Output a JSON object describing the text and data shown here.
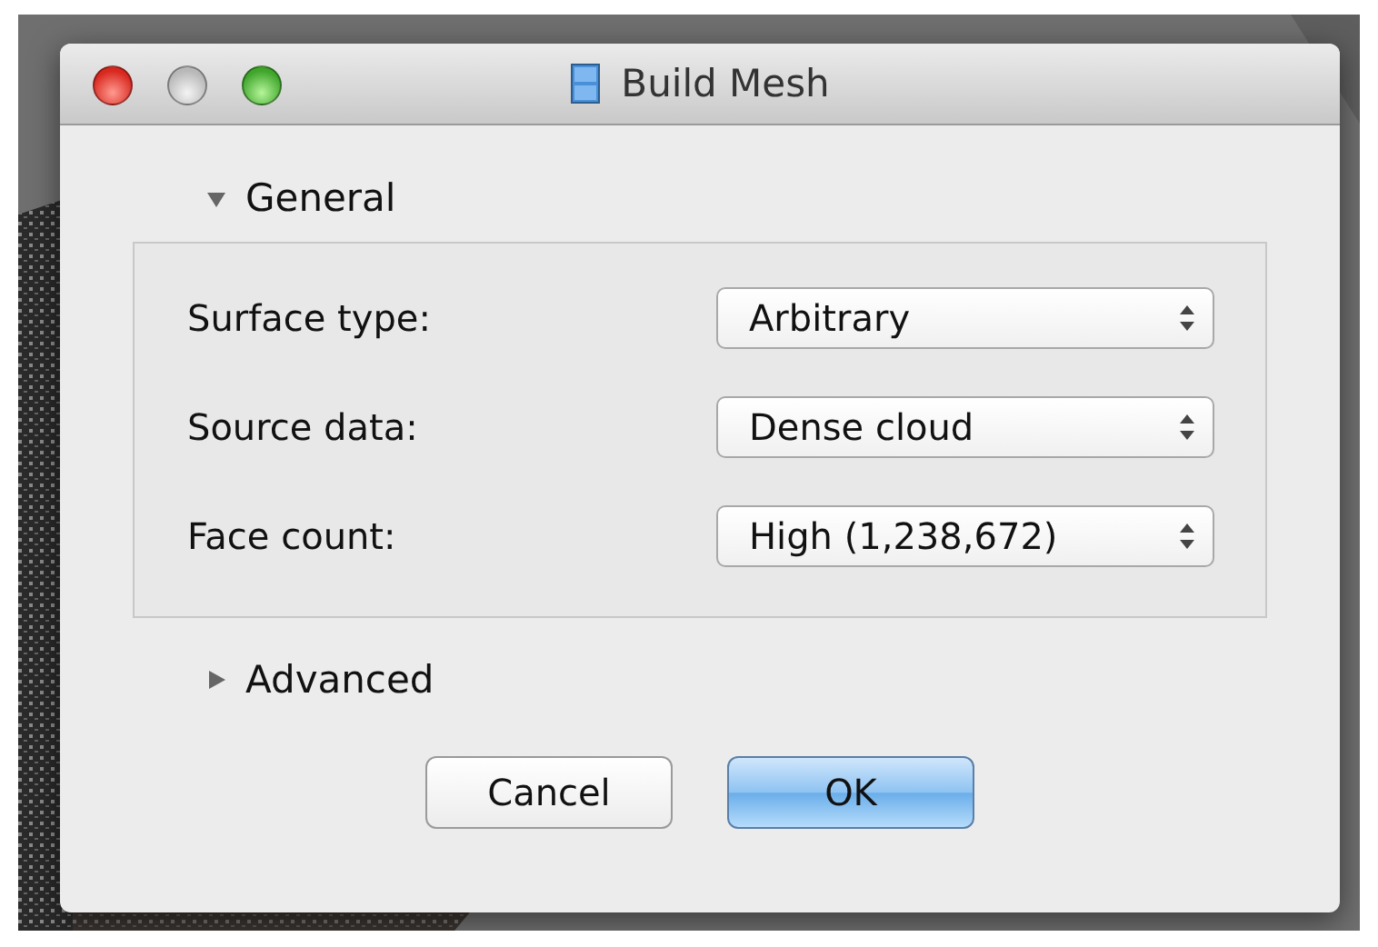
{
  "window": {
    "title": "Build Mesh"
  },
  "sections": [
    {
      "title": "General",
      "expanded": true,
      "fields": [
        {
          "label": "Surface type:",
          "value": "Arbitrary"
        },
        {
          "label": "Source data:",
          "value": "Dense cloud"
        },
        {
          "label": "Face count:",
          "value": "High (1,238,672)"
        }
      ]
    },
    {
      "title": "Advanced",
      "expanded": false
    }
  ],
  "buttons": [
    {
      "label": "Cancel",
      "default": false
    },
    {
      "label": "OK",
      "default": true
    }
  ]
}
